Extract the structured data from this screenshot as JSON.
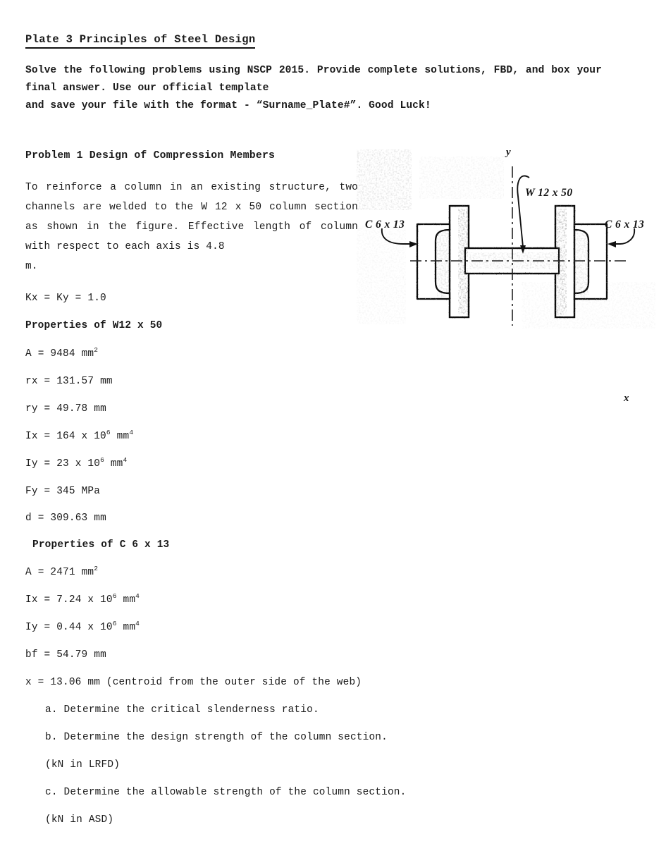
{
  "document": {
    "title": "Plate 3 Principles of Steel Design",
    "intro_line1": "Solve the following problems using NSCP 2015. Provide complete",
    "intro_line2": "solutions, FBD, and box your final answer. Use our official template",
    "intro_line3": "and save your file with the format - “Surname_Plate#”. Good Luck!"
  },
  "problem": {
    "heading": "Problem 1 Design of Compression Members",
    "body": "To reinforce a column in an existing structure, two channels are welded to the W 12 x 50 column section as shown in the figure. Effective length of column with respect to each axis is 4.8",
    "body_tail": "m.",
    "k_values": "Kx = Ky = 1.0"
  },
  "properties_w": {
    "heading": "Properties of W12 x 50",
    "rows": [
      {
        "label": "A",
        "eq": "=",
        "value": "9484",
        "unit": "mm",
        "unit_sup": "2"
      },
      {
        "label": "rx",
        "eq": "=",
        "value": "131.57",
        "unit": "mm",
        "unit_sup": ""
      },
      {
        "label": "ry",
        "eq": "=",
        "value": "49.78",
        "unit": "mm",
        "unit_sup": ""
      },
      {
        "label": "Ix",
        "eq": "=",
        "value": "164 x 10",
        "value_sup": "6",
        "unit": "mm",
        "unit_sup": "4"
      },
      {
        "label": "Iy",
        "eq": "=",
        "value": "23 x 10",
        "value_sup": "6",
        "unit": "mm",
        "unit_sup": "4"
      },
      {
        "label": "Fy",
        "eq": "=",
        "value": "345",
        "unit": "MPa",
        "unit_sup": ""
      },
      {
        "label": "d",
        "eq": "=",
        "value": "309.63",
        "unit": "mm",
        "unit_sup": ""
      }
    ]
  },
  "properties_c": {
    "heading": "Properties of C 6 x 13",
    "rows": [
      {
        "label": "A",
        "eq": "=",
        "value": "2471",
        "unit": "mm",
        "unit_sup": "2"
      },
      {
        "label": "Ix",
        "eq": "=",
        "value": "7.24 x 10",
        "value_sup": "6",
        "unit": "mm",
        "unit_sup": "4"
      },
      {
        "label": "Iy",
        "eq": "=",
        "value": "0.44 x 10",
        "value_sup": "6",
        "unit": "mm",
        "unit_sup": "4"
      },
      {
        "label": "bf",
        "eq": "=",
        "value": "54.79",
        "unit": "mm",
        "unit_sup": ""
      }
    ],
    "centroid_line": "x = 13.06 mm (centroid from the outer side of the web)"
  },
  "questions": [
    "a. Determine the critical slenderness ratio.",
    "b. Determine the design strength of the column section.",
    "(kN in LRFD)",
    "c. Determine the allowable strength of the column section.",
    "(kN in ASD)"
  ],
  "figure": {
    "axis_y_label": "y",
    "axis_x_label": "x",
    "w_section_label": "W 12 x 50",
    "channel_left_label": "C 6 x 13",
    "channel_right_label": "C 6 x 13"
  },
  "colors": {
    "ink": "#1a1a1a",
    "line": "#111111",
    "page": "#ffffff"
  }
}
